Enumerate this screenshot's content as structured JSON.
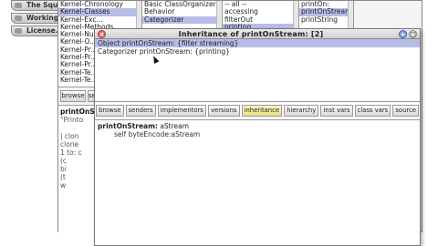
{
  "flaps": [
    "The Squ...",
    "Working...",
    "License..."
  ],
  "browser": {
    "packages": [
      "Kernel-Chronology",
      "Kernel-Classes",
      "Kernel-Exc...",
      "Kernel-Methods",
      "Kernel-Nu...",
      "Kernel-O...",
      "Kernel-Pr...",
      "Kernel-Pr...",
      "Kernel-Pr...",
      "Kernel-Te...",
      "Kernel-Te..."
    ],
    "packages_selected": 1,
    "classes": [
      "Basic ClassOrganizer",
      "Behavior",
      "Categorizer"
    ],
    "classes_selected": 2,
    "protocols": [
      "-- all --",
      "accessing",
      "filterOut",
      "printing"
    ],
    "protocols_selected": 3,
    "methods": [
      "printOn:",
      "printOnStream:",
      "printString"
    ],
    "methods_selected": 1,
    "buttons": [
      "browse",
      "se..."
    ],
    "code_lines": [
      "printOnS...",
      "\"Printo",
      "",
      "| clon",
      "clone",
      "1 to: c",
      "(c",
      "bi",
      "(t",
      "w"
    ]
  },
  "inheritance": {
    "title": "Inheritance of printOnStream: [2]",
    "rows": [
      "Object printOnStream: {filter streaming}",
      "Categorizer printOnStream: {printing}"
    ],
    "selected": 0,
    "tabs": [
      "browse",
      "senders",
      "implementors",
      "versions",
      "inheritance",
      "hierarchy",
      "inst vars",
      "class vars",
      "source"
    ],
    "active_tab": 4,
    "source_sig": "printOnStream:",
    "source_arg": " aStream",
    "source_body": "self byteEncode:aStream"
  }
}
